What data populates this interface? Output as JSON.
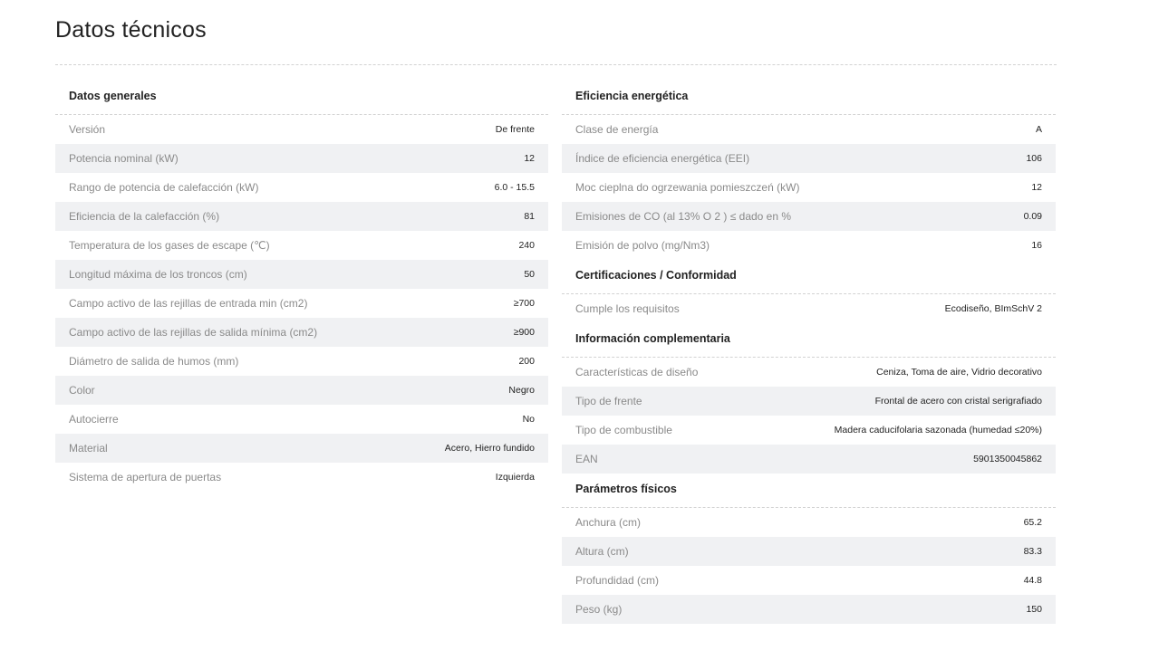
{
  "page_title": "Datos técnicos",
  "left": {
    "sections": [
      {
        "title": "Datos generales",
        "rows": [
          {
            "label": "Versión",
            "value": "De frente"
          },
          {
            "label": "Potencia nominal (kW)",
            "value": "12"
          },
          {
            "label": "Rango de potencia de calefacción (kW)",
            "value": "6.0 - 15.5"
          },
          {
            "label": "Eficiencia de la calefacción (%)",
            "value": "81"
          },
          {
            "label": "Temperatura de los gases de escape (℃)",
            "value": "240"
          },
          {
            "label": "Longitud máxima de los troncos (cm)",
            "value": "50"
          },
          {
            "label": "Campo activo de las rejillas de entrada min (cm2)",
            "value": "≥700"
          },
          {
            "label": "Campo activo de las rejillas de salida mínima (cm2)",
            "value": "≥900"
          },
          {
            "label": "Diámetro de salida de humos (mm)",
            "value": "200"
          },
          {
            "label": "Color",
            "value": "Negro"
          },
          {
            "label": "Autocierre",
            "value": "No"
          },
          {
            "label": "Material",
            "value": "Acero, Hierro fundido"
          },
          {
            "label": "Sistema de apertura de puertas",
            "value": "Izquierda"
          }
        ]
      }
    ]
  },
  "right": {
    "sections": [
      {
        "title": "Eficiencia energética",
        "rows": [
          {
            "label": "Clase de energía",
            "value": "A"
          },
          {
            "label": "Índice de eficiencia energética (EEI)",
            "value": "106"
          },
          {
            "label": "Moc cieplna do ogrzewania pomieszczeń (kW)",
            "value": "12"
          },
          {
            "label": "Emisiones de CO (al 13% O 2 ) ≤ dado en %",
            "value": "0.09"
          },
          {
            "label": "Emisión de polvo (mg/Nm3)",
            "value": "16"
          }
        ]
      },
      {
        "title": "Certificaciones / Conformidad",
        "rows": [
          {
            "label": "Cumple los requisitos",
            "value": "Ecodiseño, BImSchV 2"
          }
        ]
      },
      {
        "title": "Información complementaria",
        "rows": [
          {
            "label": "Características de diseño",
            "value": "Ceniza, Toma de aire, Vidrio decorativo"
          },
          {
            "label": "Tipo de frente",
            "value": "Frontal de acero con cristal serigrafiado"
          },
          {
            "label": "Tipo de combustible",
            "value": "Madera caducifolaria sazonada (humedad ≤20%)"
          },
          {
            "label": "EAN",
            "value": "5901350045862"
          }
        ]
      },
      {
        "title": "Parámetros físicos",
        "rows": [
          {
            "label": "Anchura (cm)",
            "value": "65.2"
          },
          {
            "label": "Altura (cm)",
            "value": "83.3"
          },
          {
            "label": "Profundidad (cm)",
            "value": "44.8"
          },
          {
            "label": "Peso (kg)",
            "value": "150"
          }
        ]
      }
    ]
  }
}
